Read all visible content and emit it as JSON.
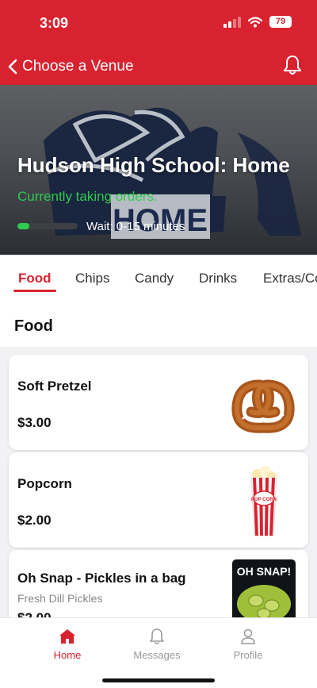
{
  "status_bar": {
    "time": "3:09",
    "battery": "79"
  },
  "nav": {
    "back_label": "Choose a Venue"
  },
  "venue": {
    "title": "Hudson High School: Home",
    "order_status": "Currently taking orders.",
    "wait_text": "Wait: 0-15 minutes",
    "wait_level": 0.2,
    "logo_text": "HOME"
  },
  "tabs": [
    "Food",
    "Chips",
    "Candy",
    "Drinks",
    "Extras/Co"
  ],
  "active_tab": "Food",
  "section": {
    "title": "Food"
  },
  "items": [
    {
      "name": "Soft Pretzel",
      "description": "",
      "price": "$3.00",
      "icon": "pretzel-image"
    },
    {
      "name": "Popcorn",
      "description": "",
      "price": "$2.00",
      "icon": "popcorn-image",
      "image_text": "POP CORN"
    },
    {
      "name": "Oh Snap - Pickles in a bag",
      "description": "Fresh Dill Pickles",
      "price": "$2.00",
      "icon": "pickles-bag-image",
      "image_text": "OH SNAP!"
    }
  ],
  "bottom_nav": [
    {
      "label": "Home",
      "icon": "home-icon",
      "active": true
    },
    {
      "label": "Messages",
      "icon": "bell-icon",
      "active": false
    },
    {
      "label": "Profile",
      "icon": "person-icon",
      "active": false
    }
  ],
  "colors": {
    "brand_red": "#d9222f",
    "status_green": "#2ecc4e"
  }
}
